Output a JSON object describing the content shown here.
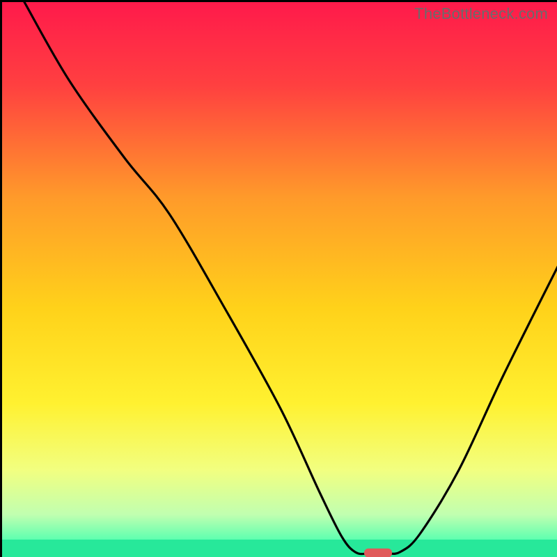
{
  "attribution": "TheBottleneck.com",
  "chart_data": {
    "type": "line",
    "title": "",
    "xlabel": "",
    "ylabel": "",
    "xlim": [
      0,
      100
    ],
    "ylim": [
      0,
      100
    ],
    "grid": false,
    "legend": false,
    "background_gradient": {
      "stops": [
        {
          "pos": 0.0,
          "color": "#ff1a4b"
        },
        {
          "pos": 0.15,
          "color": "#ff4040"
        },
        {
          "pos": 0.35,
          "color": "#ff9a2a"
        },
        {
          "pos": 0.55,
          "color": "#ffd21a"
        },
        {
          "pos": 0.72,
          "color": "#fff130"
        },
        {
          "pos": 0.84,
          "color": "#f2ff80"
        },
        {
          "pos": 0.92,
          "color": "#c1ffb0"
        },
        {
          "pos": 0.965,
          "color": "#5effb0"
        },
        {
          "pos": 1.0,
          "color": "#27e89a"
        }
      ]
    },
    "series": [
      {
        "name": "bottleneck-curve",
        "color": "#000000",
        "points": [
          {
            "x": 4.0,
            "y": 100.0
          },
          {
            "x": 12.0,
            "y": 86.0
          },
          {
            "x": 22.0,
            "y": 72.0
          },
          {
            "x": 30.0,
            "y": 62.0
          },
          {
            "x": 40.0,
            "y": 45.0
          },
          {
            "x": 50.0,
            "y": 27.0
          },
          {
            "x": 57.0,
            "y": 12.0
          },
          {
            "x": 61.0,
            "y": 4.0
          },
          {
            "x": 63.5,
            "y": 1.2
          },
          {
            "x": 66.0,
            "y": 1.0
          },
          {
            "x": 69.0,
            "y": 1.0
          },
          {
            "x": 71.5,
            "y": 1.3
          },
          {
            "x": 75.0,
            "y": 4.5
          },
          {
            "x": 82.0,
            "y": 16.0
          },
          {
            "x": 90.0,
            "y": 33.0
          },
          {
            "x": 100.0,
            "y": 53.0
          }
        ]
      }
    ],
    "optimal_marker": {
      "color": "#e05a5a",
      "x_center": 67.5,
      "y": 1.1,
      "width": 5.0,
      "height": 1.6
    },
    "bottom_band": {
      "color": "#27e89a",
      "y_from": 0,
      "y_to": 3.5
    }
  }
}
